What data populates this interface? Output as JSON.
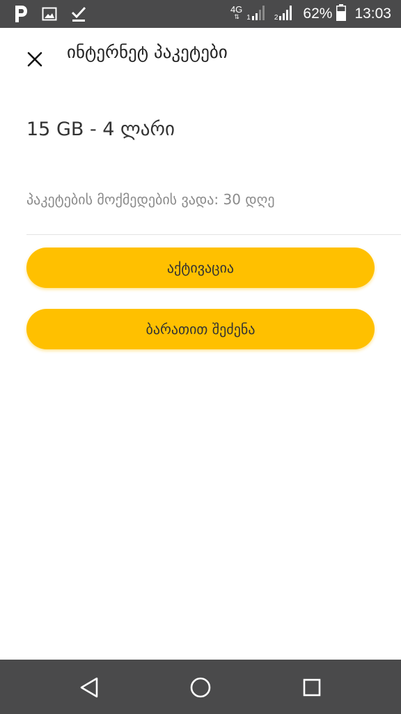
{
  "status_bar": {
    "left_icons": [
      "p-app-icon",
      "image-icon",
      "download-done-icon"
    ],
    "network_type": "4G",
    "network_arrows": "⇅",
    "sim1_label": "1",
    "sim2_label": "2",
    "battery_percent": "62%",
    "time": "13:03"
  },
  "header": {
    "close_icon": "close-icon",
    "title": "ინტერნეტ პაკეტები"
  },
  "package": {
    "name": "15 GB - 4 ლარი",
    "validity": "პაკეტების მოქმედების ვადა: 30 დღე"
  },
  "actions": {
    "activate_label": "აქტივაცია",
    "buy_with_card_label": "ბარათით შეძენა"
  },
  "nav_bar": {
    "back_icon": "back-triangle-icon",
    "home_icon": "home-circle-icon",
    "recent_icon": "recent-apps-square-icon"
  },
  "colors": {
    "accent": "#ffc000",
    "system_bar": "#4a4a4b",
    "title_text": "#222222",
    "secondary_text": "#8a8a8a"
  }
}
